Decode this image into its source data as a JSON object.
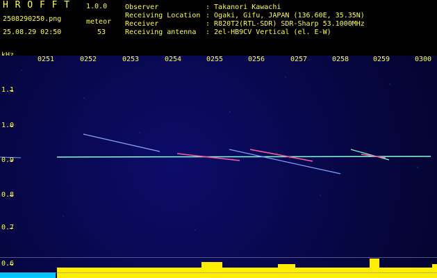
{
  "app": {
    "title": "H R O F F T",
    "version": "1.0.0"
  },
  "file": {
    "name": "2508290250.png",
    "datetime": "25.08.29 02:50"
  },
  "meteor": {
    "label": "meteor",
    "count": "53"
  },
  "info": [
    {
      "label": "Observer",
      "value": ": Takanori Kawachi"
    },
    {
      "label": "Receiving Location",
      "value": ": Ogaki, Gifu, JAPAN (136.60E, 35.35N)"
    },
    {
      "label": "Receiver",
      "value": ": R820T2(RTL-SDR) SDR-Sharp 53.1000MHz"
    },
    {
      "label": "Receiving antenna",
      "value": ": 2el-HB9CV Vertical (el. E-W)"
    }
  ],
  "axis": {
    "unit": "kHz",
    "y_ticks": [
      "1.1",
      "1.0",
      "0.9",
      "0.8",
      "0.7",
      "0.6"
    ],
    "x_ticks": [
      "0251",
      "0252",
      "0253",
      "0254",
      "0255",
      "0256",
      "0257",
      "0258",
      "0259",
      "0300"
    ]
  },
  "colors": {
    "label": "#ffff3c",
    "background": "#060640",
    "carrier": "#7fffd4",
    "meteor": "#ff5aa0",
    "level": "#ffff00"
  }
}
